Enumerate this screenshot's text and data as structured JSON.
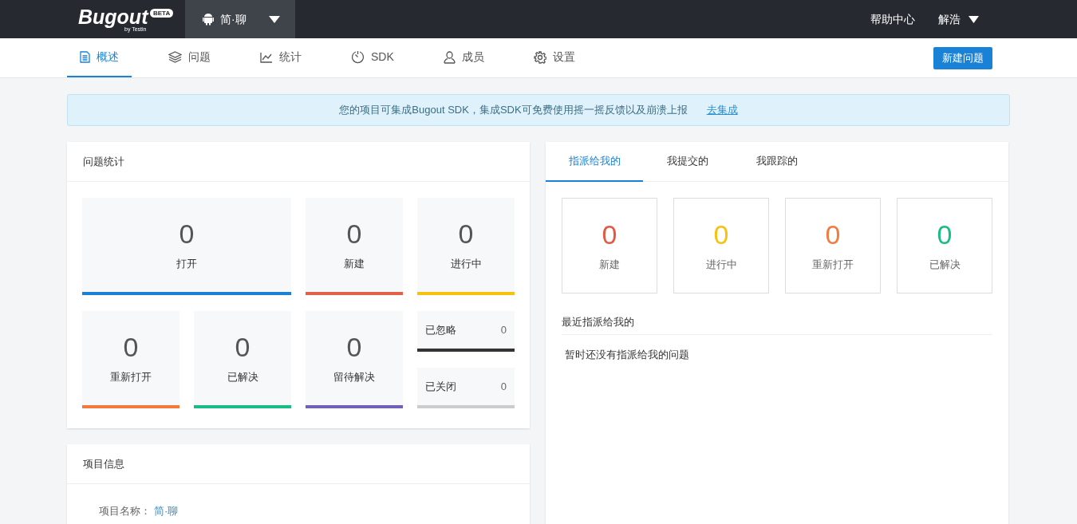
{
  "top_bar": {
    "logo": {
      "text": "Bugout",
      "badge": "BETA",
      "sub": "by Testin"
    },
    "project": "简·聊",
    "help": "帮助中心",
    "user": "解浩"
  },
  "nav": {
    "tabs": [
      {
        "label": "概述",
        "selected": true
      },
      {
        "label": "问题",
        "selected": false
      },
      {
        "label": "统计",
        "selected": false
      },
      {
        "label": "SDK",
        "selected": false
      },
      {
        "label": "成员",
        "selected": false
      },
      {
        "label": "设置",
        "selected": false
      }
    ],
    "new_button": "新建问题"
  },
  "banner": {
    "text": "您的项目可集成Bugout SDK，集成SDK可免费使用摇一摇反馈以及崩溃上报",
    "link": "去集成"
  },
  "issue_stats": {
    "title": "问题统计",
    "tiles": [
      {
        "kind": "large",
        "count": "0",
        "label": "打开",
        "color": "#1a82d6"
      },
      {
        "kind": "medium",
        "count": "0",
        "label": "新建",
        "color": "#e0604a"
      },
      {
        "kind": "medium",
        "count": "0",
        "label": "进行中",
        "color": "#f5c211"
      },
      {
        "kind": "medium",
        "count": "0",
        "label": "重新打开",
        "color": "#f47a3c"
      },
      {
        "kind": "medium",
        "count": "0",
        "label": "已解决",
        "color": "#1abc85"
      },
      {
        "kind": "medium",
        "count": "0",
        "label": "留待解决",
        "color": "#7060b8"
      },
      {
        "kind": "small",
        "count": "0",
        "label": "已忽略",
        "color": "#333333"
      },
      {
        "kind": "small",
        "count": "0",
        "label": "已关闭",
        "color": "#cccccc"
      }
    ]
  },
  "project_info": {
    "title": "项目信息",
    "fields": [
      {
        "label": "项目名称：",
        "value": "简·聊"
      }
    ]
  },
  "assigned": {
    "tabs": [
      {
        "label": "指派给我的",
        "selected": true
      },
      {
        "label": "我提交的",
        "selected": false
      },
      {
        "label": "我跟踪的",
        "selected": false
      }
    ],
    "tiles": [
      {
        "count": "0",
        "label": "新建",
        "color": "#e05a45"
      },
      {
        "count": "0",
        "label": "进行中",
        "color": "#f5c211"
      },
      {
        "count": "0",
        "label": "重新打开",
        "color": "#f07c42"
      },
      {
        "count": "0",
        "label": "已解决",
        "color": "#1cbb84"
      }
    ],
    "recent_title": "最近指派给我的",
    "empty_text": "暂时还没有指派给我的问题"
  }
}
